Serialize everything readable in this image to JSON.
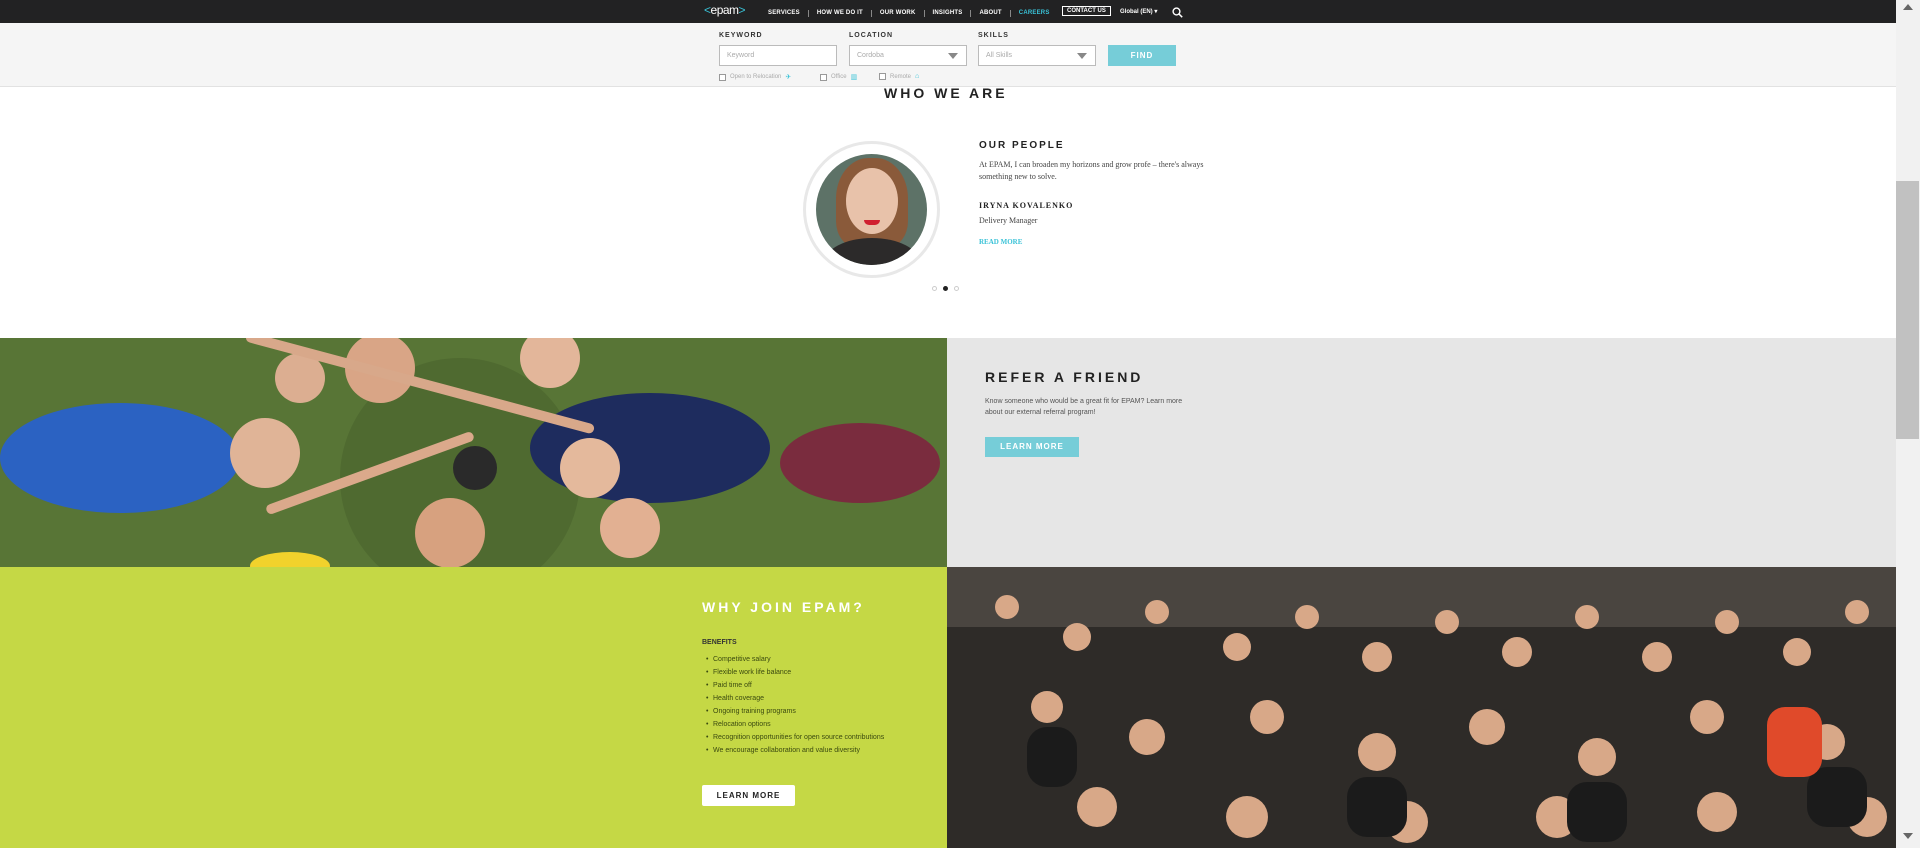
{
  "nav": {
    "logo_left": "<",
    "logo_text": "epam",
    "logo_right": ">",
    "links": [
      "SERVICES",
      "HOW WE DO IT",
      "OUR WORK",
      "INSIGHTS",
      "ABOUT",
      "CAREERS"
    ],
    "active": "CAREERS",
    "contact": "CONTACT US",
    "global": "Global (EN) ▾",
    "search_icon": "search-icon"
  },
  "search": {
    "keyword_label": "KEYWORD",
    "keyword_placeholder": "Keyword",
    "location_label": "LOCATION",
    "location_value": "Cordoba",
    "skills_label": "SKILLS",
    "skills_value": "All Skills",
    "find": "FIND",
    "relocation": "Open to Relocation",
    "office": "Office",
    "remote": "Remote"
  },
  "who": {
    "title": "WHO WE ARE",
    "heading": "OUR PEOPLE",
    "quote": "At EPAM, I can broaden my horizons and grow profe – there's always something new to solve.",
    "name": "IRYNA KOVALENKO",
    "role": "Delivery Manager",
    "read_more": "READ MORE",
    "active_dot": 1
  },
  "refer": {
    "title": "REFER A FRIEND",
    "text": "Know someone who would be a great fit for EPAM? Learn more about our external referral program!",
    "button": "LEARN MORE"
  },
  "why": {
    "title": "WHY JOIN EPAM?",
    "subtitle": "BENEFITS",
    "items": [
      "Competitive salary",
      "Flexible work life balance",
      "Paid time off",
      "Health coverage",
      "Ongoing training programs",
      "Relocation options",
      "Recognition opportunities for open source contributions",
      "We encourage collaboration and value diversity"
    ],
    "button": "LEARN MORE"
  },
  "colors": {
    "accent": "#39c2d7",
    "lime": "#c5d845",
    "nav_bg": "#222223"
  }
}
